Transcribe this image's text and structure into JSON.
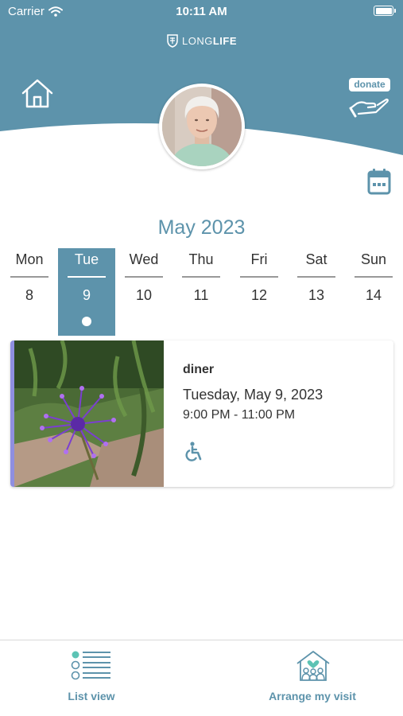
{
  "status_bar": {
    "carrier": "Carrier",
    "time": "10:11 AM"
  },
  "brand": {
    "light": "LONG",
    "bold": "LIFE"
  },
  "header": {
    "donate_label": "donate",
    "home_icon": "home-icon",
    "hand_icon": "hand-icon",
    "calendar_icon": "calendar-icon"
  },
  "calendar": {
    "month_title": "May 2023",
    "days": [
      {
        "name": "Mon",
        "num": "8"
      },
      {
        "name": "Tue",
        "num": "9"
      },
      {
        "name": "Wed",
        "num": "10"
      },
      {
        "name": "Thu",
        "num": "11"
      },
      {
        "name": "Fri",
        "num": "12"
      },
      {
        "name": "Sat",
        "num": "13"
      },
      {
        "name": "Sun",
        "num": "14"
      }
    ],
    "selected_day": "Tue"
  },
  "event": {
    "title": "diner",
    "date": "Tuesday, May 9, 2023",
    "time": "9:00 PM - 11:00 PM",
    "icon": "wheelchair-accessible-icon"
  },
  "tabs": [
    {
      "label": "List view",
      "icon": "list-view-icon"
    },
    {
      "label": "Arrange my visit",
      "icon": "house-family-icon"
    }
  ],
  "colors": {
    "primary": "#5d93ab",
    "accent_bar": "#8f8fe0",
    "background": "#ffffff"
  }
}
